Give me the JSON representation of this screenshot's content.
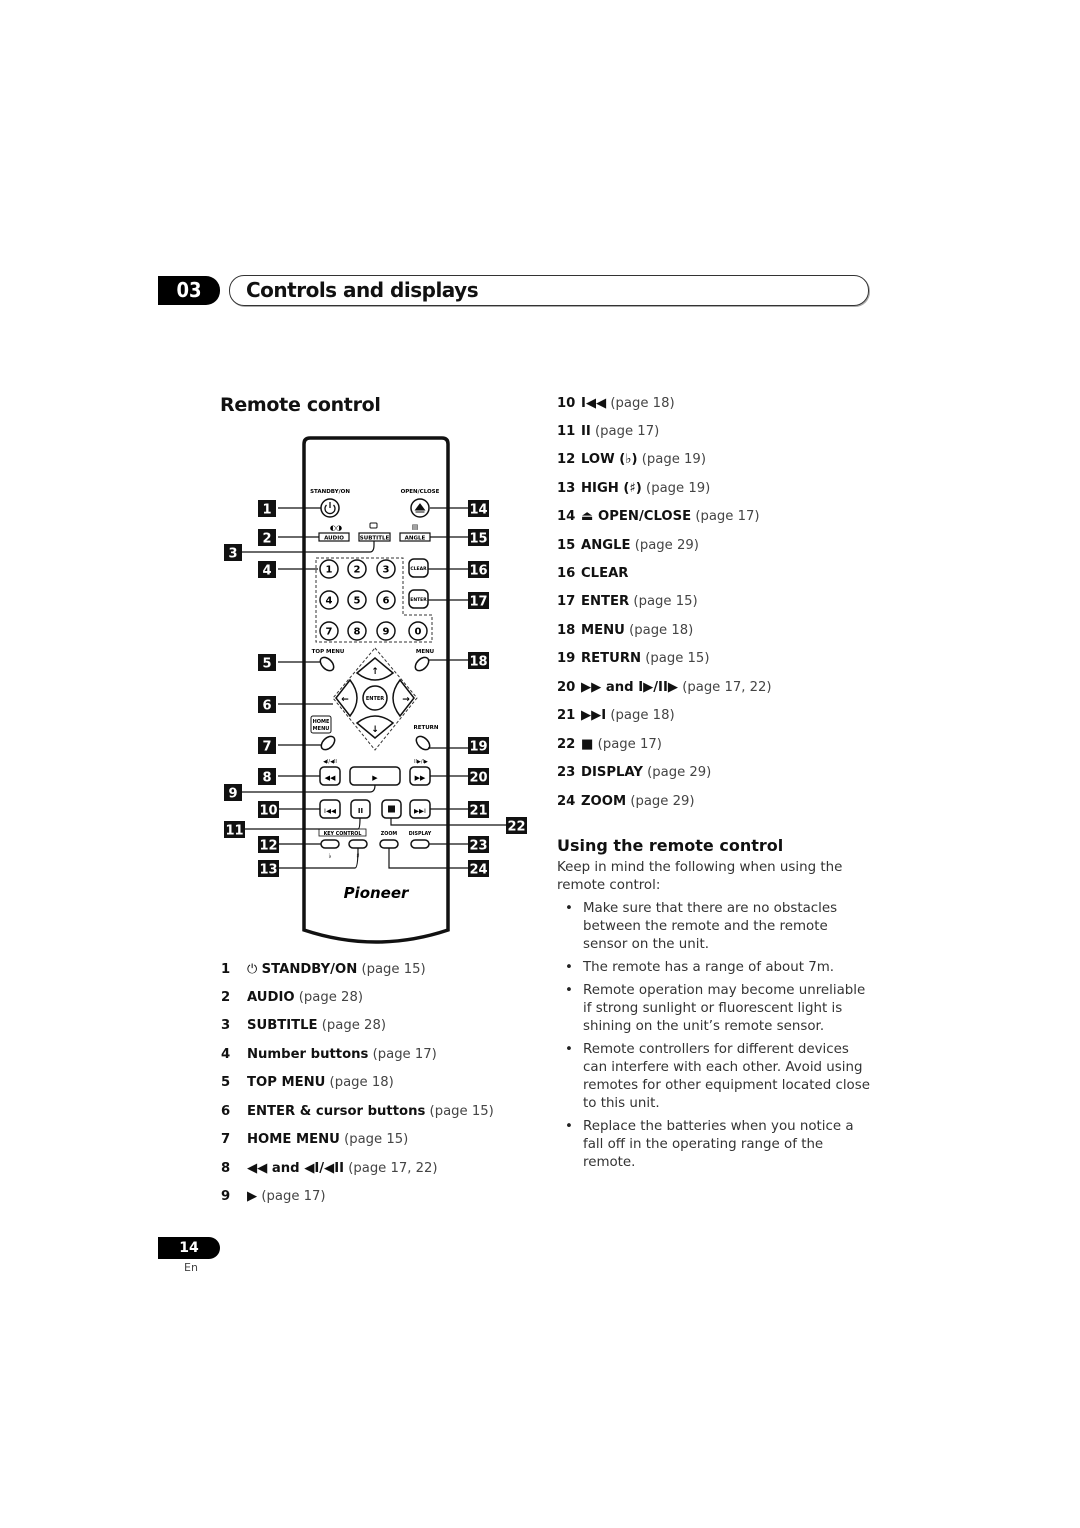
{
  "header": {
    "chapter_number": "03",
    "chapter_title": "Controls and displays"
  },
  "section": {
    "title": "Remote control"
  },
  "remote": {
    "brand": "Pioneer",
    "labels": {
      "standby": "STANDBY/ON",
      "open_close": "OPEN/CLOSE",
      "audio": "AUDIO",
      "subtitle": "SUBTITLE",
      "angle": "ANGLE",
      "clear": "CLEAR",
      "enter_small": "ENTER",
      "top_menu": "TOP MENU",
      "menu": "MENU",
      "enter": "ENTER",
      "home": "HOME",
      "menu2": "MENU",
      "return": "RETURN",
      "step_back": "◀I/◀II",
      "step_fwd": "II▶/I▶",
      "key_control": "KEY CONTROL",
      "zoom": "ZOOM",
      "display": "DISPLAY",
      "flat": "♭",
      "sharp": "♯"
    },
    "digits": [
      "1",
      "2",
      "3",
      "4",
      "5",
      "6",
      "7",
      "8",
      "9",
      "0"
    ],
    "callouts_left": [
      "1",
      "2",
      "3",
      "4",
      "5",
      "6",
      "7",
      "8",
      "9",
      "10",
      "11",
      "12",
      "13"
    ],
    "callouts_right": [
      "14",
      "15",
      "16",
      "17",
      "18",
      "19",
      "20",
      "21",
      "22",
      "23",
      "24"
    ]
  },
  "left_list": [
    {
      "num": "1",
      "icon": "⏻",
      "label": "STANDBY/ON",
      "ref": "(page 15)"
    },
    {
      "num": "2",
      "icon": "",
      "label": "AUDIO",
      "ref": "(page 28)"
    },
    {
      "num": "3",
      "icon": "",
      "label": "SUBTITLE",
      "ref": "(page 28)"
    },
    {
      "num": "4",
      "icon": "",
      "label": "Number buttons",
      "ref": "(page 17)"
    },
    {
      "num": "5",
      "icon": "",
      "label": "TOP MENU",
      "ref": "(page 18)"
    },
    {
      "num": "6",
      "icon": "",
      "label": "ENTER & cursor buttons",
      "ref": "(page 15)"
    },
    {
      "num": "7",
      "icon": "",
      "label": "HOME MENU",
      "ref": "(page 15)"
    },
    {
      "num": "8",
      "icon": "",
      "label": "◀◀ and ◀I/◀II",
      "ref": "(page 17, 22)"
    },
    {
      "num": "9",
      "icon": "",
      "label": "▶",
      "ref": "(page 17)"
    }
  ],
  "right_list": [
    {
      "num": "10",
      "label": "I◀◀",
      "ref": "(page 18)"
    },
    {
      "num": "11",
      "label": "II",
      "ref": "(page 17)"
    },
    {
      "num": "12",
      "label": "LOW (♭)",
      "ref": "(page 19)"
    },
    {
      "num": "13",
      "label": "HIGH (♯)",
      "ref": "(page 19)"
    },
    {
      "num": "14",
      "label": "⏏ OPEN/CLOSE",
      "ref": "(page 17)"
    },
    {
      "num": "15",
      "label": "ANGLE",
      "ref": "(page 29)"
    },
    {
      "num": "16",
      "label": "CLEAR",
      "ref": ""
    },
    {
      "num": "17",
      "label": "ENTER",
      "ref": "(page 15)"
    },
    {
      "num": "18",
      "label": "MENU",
      "ref": "(page 18)"
    },
    {
      "num": "19",
      "label": "RETURN",
      "ref": "(page 15)"
    },
    {
      "num": "20",
      "label": "▶▶ and I▶/II▶",
      "ref": "(page 17, 22)"
    },
    {
      "num": "21",
      "label": "▶▶I",
      "ref": "(page 18)"
    },
    {
      "num": "22",
      "label": "■",
      "ref": "(page 17)"
    },
    {
      "num": "23",
      "label": "DISPLAY",
      "ref": "(page 29)"
    },
    {
      "num": "24",
      "label": "ZOOM",
      "ref": "(page 29)"
    }
  ],
  "using": {
    "title": "Using the remote control",
    "intro": "Keep in mind the following when using the remote control:",
    "bullets": [
      "Make sure that there are no obstacles between the remote and the remote sensor on the unit.",
      "The remote has a range of about 7m.",
      "Remote operation may become unreliable if strong sunlight or fluorescent light is shining on the unit’s remote sensor.",
      "Remote controllers for different devices can interfere with each other. Avoid using remotes for other equipment located close to this unit.",
      "Replace the batteries when you notice a fall off in the operating range of the remote."
    ]
  },
  "footer": {
    "page_number": "14",
    "language": "En"
  }
}
